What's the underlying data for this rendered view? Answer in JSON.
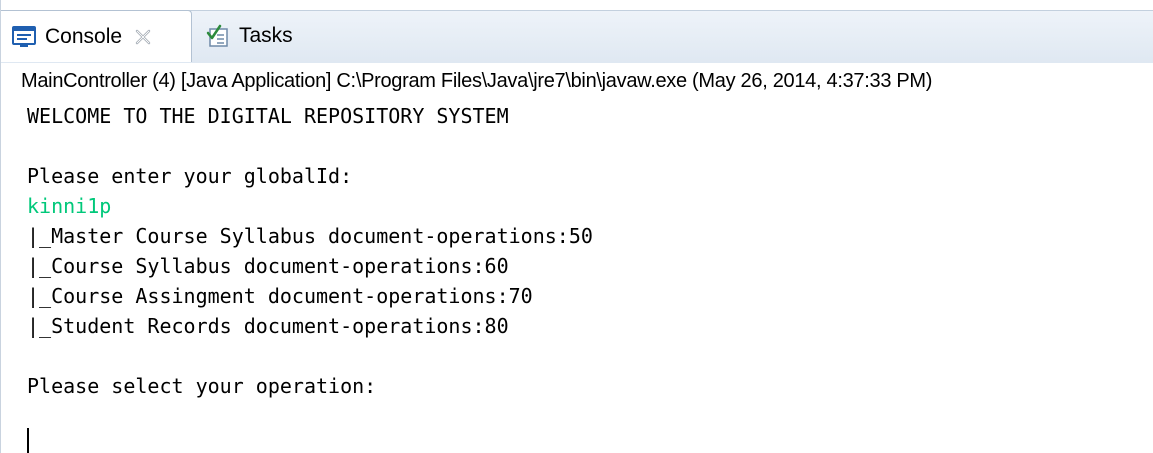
{
  "tabs": [
    {
      "label": "Console",
      "icon": "console-icon",
      "closable": true,
      "active": true
    },
    {
      "label": "Tasks",
      "icon": "tasks-icon",
      "closable": false,
      "active": false
    }
  ],
  "launch": {
    "description": "MainController (4) [Java Application] C:\\Program Files\\Java\\jre7\\bin\\javaw.exe (May 26, 2014, 4:37:33 PM)"
  },
  "console": {
    "lines": [
      "WELCOME TO THE DIGITAL REPOSITORY SYSTEM",
      "",
      "Please enter your globalId:",
      "kinni1p",
      "|_Master Course Syllabus document-operations:50",
      "|_Course Syllabus document-operations:60",
      "|_Course Assingment document-operations:70",
      "|_Student Records document-operations:80",
      "",
      "Please select your operation:"
    ],
    "input_line_index": 3
  },
  "colors": {
    "stdin_text": "#00c87a",
    "stdout_text": "#000000",
    "tab_strip": "#dfe8f2",
    "console_icon_blue": "#1f5fb0"
  }
}
